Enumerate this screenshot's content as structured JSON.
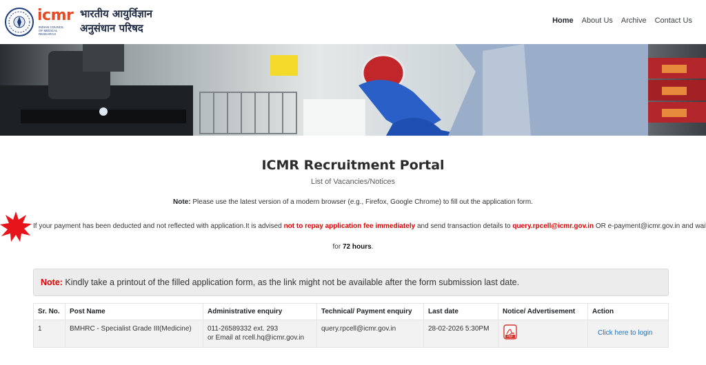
{
  "header": {
    "brand": "icmr",
    "brand_sub": "INDIAN COUNCIL OF MEDICAL RESEARCH",
    "hindi_line1": "भारतीय आयुर्विज्ञान",
    "hindi_line2": "अनुसंधान परिषद",
    "nav": [
      "Home",
      "About Us",
      "Archive",
      "Contact Us"
    ]
  },
  "main": {
    "title": "ICMR Recruitment Portal",
    "subtitle": "List of Vacancies/Notices",
    "note_label": "Note:",
    "note_text": " Please use the latest version of a modern browser (e.g., Firefox, Google Chrome) to fill out the application form.",
    "payment": {
      "part1": "If your payment has been deducted and not reflected with application.It is advised ",
      "red1": "not to repay application fee immediately",
      "part2": " and send transaction details to ",
      "red2": "query.rpcell@icmr.gov.in",
      "part3": " OR e-payment@icmr.gov.in and wait",
      "part4": "for ",
      "bold1": "72 hours",
      "part5": "."
    },
    "alert_label": "Note:",
    "alert_text": " Kindly take a printout of the filled application form, as the link might not be available after the form submission last date."
  },
  "table": {
    "headers": [
      "Sr. No.",
      "Post Name",
      "Administrative enquiry",
      "Technical/ Payment enquiry",
      "Last date",
      "Notice/ Advertisement",
      "Action"
    ],
    "rows": [
      {
        "sr": "1",
        "post": "BMHRC - Specialist Grade III(Medicine)",
        "admin_line1": "011-26589332 ext. 293",
        "admin_line2": "or Email at rcell.hq@icmr.gov.in",
        "tech": "query.rpcell@icmr.gov.in",
        "last_date": "28-02-2026 5:30PM",
        "notice_icon": "pdf-icon",
        "action": "Click here to login"
      }
    ]
  },
  "colors": {
    "brand_blue": "#1d3e7d",
    "brand_orange": "#e64b28",
    "alert_red": "#e00000",
    "link_blue": "#1a73c8"
  }
}
